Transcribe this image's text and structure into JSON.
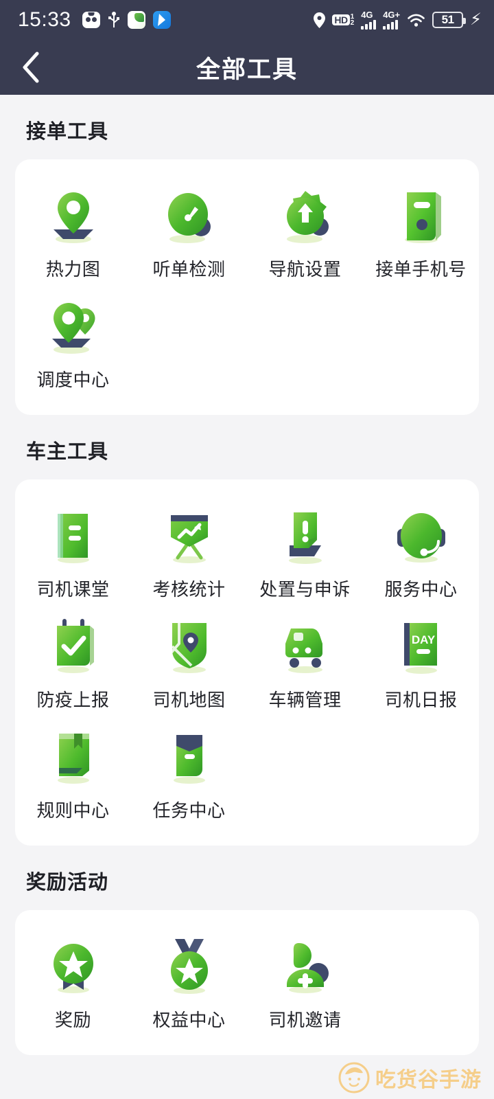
{
  "statusbar": {
    "time": "15:33",
    "left_icons": [
      "game-app-icon",
      "usb-icon",
      "green-app-icon",
      "blue-app-icon"
    ],
    "volte_label": "HD",
    "volte_sup": "1",
    "volte_sub": "2",
    "sim1_network": "4G",
    "sim2_network": "4G+",
    "wifi_icon": "wifi-icon",
    "battery_level": "51",
    "charging_icon": "lightning-bolt-icon"
  },
  "navbar": {
    "back_icon": "chevron-left-icon",
    "title": "全部工具"
  },
  "colors": {
    "header_bg": "#393c51",
    "page_bg": "#f4f4f6",
    "card_bg": "#ffffff",
    "accent_green": "#5bbf3a",
    "accent_navy": "#3f4a6b",
    "label_text": "#23242a",
    "watermark": "#f6c878"
  },
  "sections": [
    {
      "title": "接单工具",
      "items": [
        {
          "label": "热力图",
          "icon": "heatmap-pin-icon"
        },
        {
          "label": "听单检测",
          "icon": "order-listening-gauge-icon"
        },
        {
          "label": "导航设置",
          "icon": "navigation-gear-icon"
        },
        {
          "label": "接单手机号",
          "icon": "order-phone-icon"
        },
        {
          "label": "调度中心",
          "icon": "dispatch-double-pin-icon"
        }
      ]
    },
    {
      "title": "车主工具",
      "items": [
        {
          "label": "司机课堂",
          "icon": "driver-class-book-icon"
        },
        {
          "label": "考核统计",
          "icon": "assessment-chart-icon"
        },
        {
          "label": "处置与申诉",
          "icon": "appeal-exclamation-icon"
        },
        {
          "label": "服务中心",
          "icon": "headset-service-icon"
        },
        {
          "label": "防疫上报",
          "icon": "epidemic-checkmark-calendar-icon"
        },
        {
          "label": "司机地图",
          "icon": "driver-map-icon"
        },
        {
          "label": "车辆管理",
          "icon": "vehicle-car-icon"
        },
        {
          "label": "司机日报",
          "icon": "daily-report-day-icon",
          "badge_text": "DAY"
        },
        {
          "label": "规则中心",
          "icon": "rule-bookmark-book-icon"
        },
        {
          "label": "任务中心",
          "icon": "task-envelope-book-icon"
        }
      ]
    },
    {
      "title": "奖励活动",
      "items": [
        {
          "label": "奖励",
          "icon": "reward-ribbon-star-icon"
        },
        {
          "label": "权益中心",
          "icon": "medal-star-icon"
        },
        {
          "label": "司机邀请",
          "icon": "driver-invite-person-icon"
        }
      ]
    }
  ],
  "watermark": {
    "text": "吃货谷手游",
    "logo_icon": "face-logo-icon"
  }
}
